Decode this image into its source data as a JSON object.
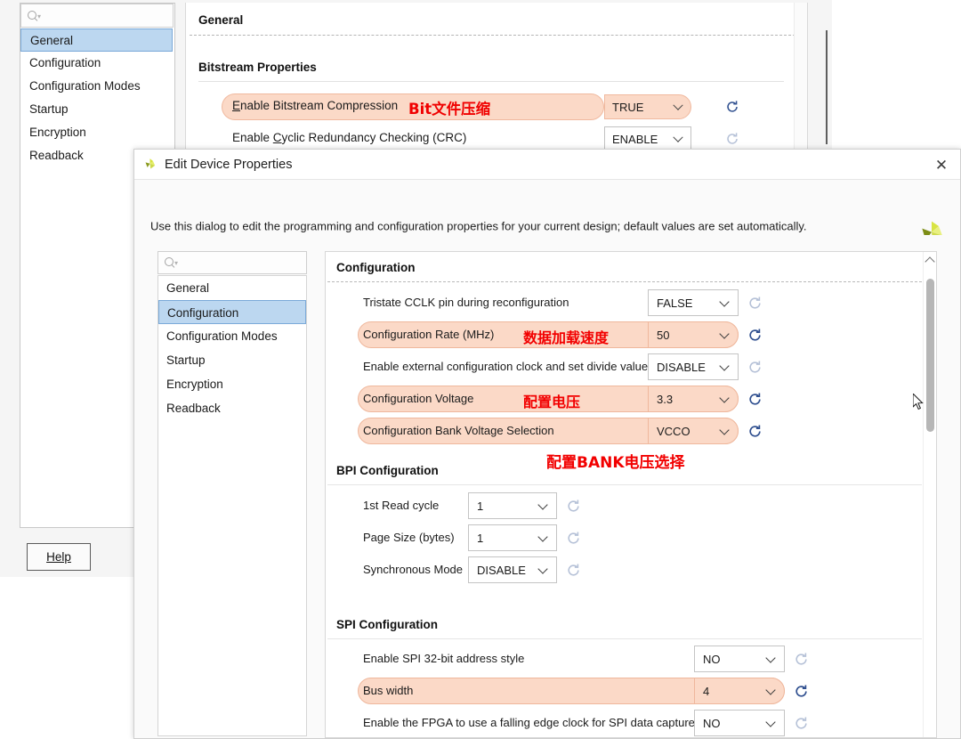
{
  "background_window": {
    "search": {
      "placeholder": "",
      "icon": "search-icon"
    },
    "nav_items": [
      {
        "label": "General",
        "selected": true
      },
      {
        "label": "Configuration",
        "selected": false
      },
      {
        "label": "Configuration Modes",
        "selected": false
      },
      {
        "label": "Startup",
        "selected": false
      },
      {
        "label": "Encryption",
        "selected": false
      },
      {
        "label": "Readback",
        "selected": false
      }
    ],
    "help_button": "Help",
    "section_title": "General",
    "subsection_title": "Bitstream Properties",
    "rows": [
      {
        "label": "Enable Bitstream Compression",
        "mnemonic": "E",
        "annotation": "Bit文件压缩",
        "value": "TRUE",
        "highlighted": true,
        "reset_icon": "reset-icon"
      },
      {
        "label": "Enable Cyclic Redundancy Checking (CRC)",
        "mnemonic": "C",
        "annotation": "",
        "value": "ENABLE",
        "highlighted": false,
        "reset_icon": "reset-icon"
      }
    ]
  },
  "dialog": {
    "title": "Edit Device Properties",
    "title_icon": "xilinx-logo-icon",
    "close_icon": "close-icon",
    "banner_text": "Use this dialog to edit the programming and configuration properties for your current design; default values are set automatically.",
    "banner_logo": "xilinx-logo-icon",
    "search": {
      "placeholder": "",
      "icon": "search-icon"
    },
    "nav_items": [
      {
        "label": "General",
        "selected": false
      },
      {
        "label": "Configuration",
        "selected": true
      },
      {
        "label": "Configuration Modes",
        "selected": false
      },
      {
        "label": "Startup",
        "selected": false
      },
      {
        "label": "Encryption",
        "selected": false
      },
      {
        "label": "Readback",
        "selected": false
      }
    ],
    "sections": [
      {
        "title": "Configuration",
        "rows": [
          {
            "label": "Tristate CCLK pin during reconfiguration",
            "value": "FALSE",
            "annotation": "",
            "highlighted": false
          },
          {
            "label": "Configuration Rate (MHz)",
            "value": "50",
            "annotation": "数据加载速度",
            "highlighted": true
          },
          {
            "label": "Enable external configuration clock and set divide value",
            "value": "DISABLE",
            "annotation": "",
            "highlighted": false
          },
          {
            "label": "Configuration Voltage",
            "value": "3.3",
            "annotation": "配置电压",
            "highlighted": true
          },
          {
            "label": "Configuration Bank Voltage Selection",
            "value": "VCCO",
            "annotation": "",
            "highlighted": true
          }
        ],
        "below_annotation": "配置BANK电压选择"
      },
      {
        "title": "BPI Configuration",
        "rows": [
          {
            "label": "1st Read cycle",
            "value": "1",
            "annotation": "",
            "highlighted": false
          },
          {
            "label": "Page Size (bytes)",
            "value": "1",
            "annotation": "",
            "highlighted": false
          },
          {
            "label": "Synchronous Mode",
            "value": "DISABLE",
            "annotation": "",
            "highlighted": false
          }
        ],
        "below_annotation": ""
      },
      {
        "title": "SPI Configuration",
        "rows": [
          {
            "label": "Enable SPI 32-bit address style",
            "value": "NO",
            "annotation": "",
            "highlighted": false
          },
          {
            "label": "Bus width",
            "value": "4",
            "annotation": "",
            "highlighted": true
          },
          {
            "label": "Enable the FPGA to use a falling edge clock for SPI data capture",
            "value": "NO",
            "annotation": "",
            "highlighted": false
          }
        ],
        "below_annotation": ""
      }
    ],
    "scrollbar": {
      "up_arrow_icon": "chevron-up-icon",
      "thumb": "scroll-thumb"
    }
  },
  "colors": {
    "highlight_fill": "#fbd9c7",
    "highlight_border": "#efb79c",
    "annotation_red": "#f20000",
    "selection_blue": "#bcd7f0",
    "xilinx_green": "#c4d600"
  }
}
